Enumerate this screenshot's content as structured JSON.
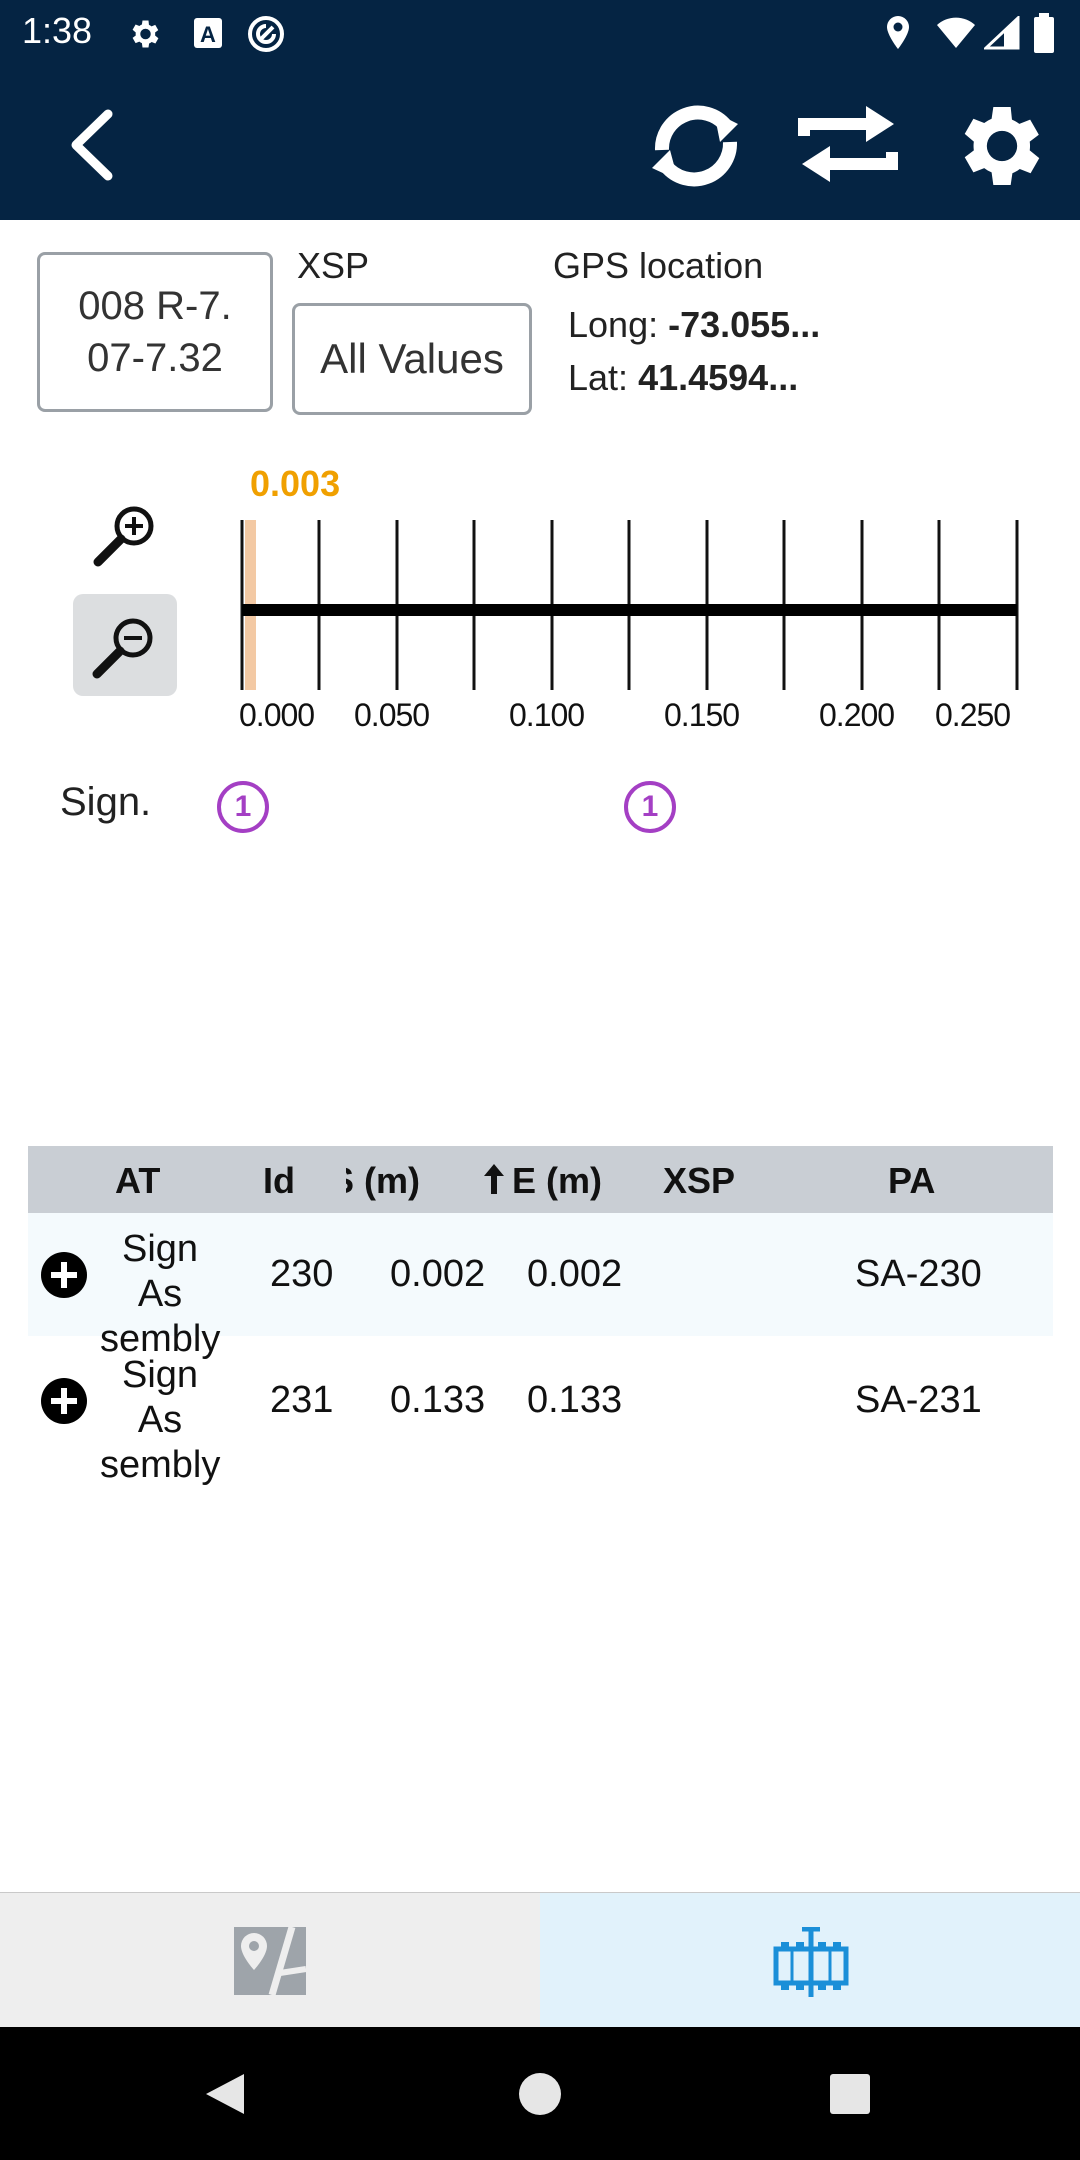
{
  "status_bar": {
    "time": "1:38",
    "left_icons": [
      "gear-icon",
      "font-a-icon",
      "at-sign-icon"
    ],
    "right_icons": [
      "location-pin-icon",
      "wifi-icon",
      "signal-icon",
      "battery-icon"
    ]
  },
  "app_bar": {
    "icons": [
      "back-arrow-icon",
      "sync-icon",
      "swap-direction-icon",
      "settings-icon"
    ],
    "background": "#052443"
  },
  "road": {
    "value": "008  R-7.\n07-7.32"
  },
  "xsp": {
    "label": "XSP",
    "value": "All Values"
  },
  "gps": {
    "title": "GPS location",
    "long_label": "Long: ",
    "long_value": "-73.055...",
    "lat_label": "Lat: ",
    "lat_value": "41.4594..."
  },
  "timeline": {
    "cursor_value": "0.003",
    "tick_labels": [
      "0.000",
      "0.050",
      "0.100",
      "0.150",
      "0.200",
      "0.250"
    ],
    "cursor_color": "#f0a000"
  },
  "sign_track": {
    "label": "Sign.",
    "markers": [
      "1",
      "1"
    ],
    "marker_color": "#a43fc4"
  },
  "table": {
    "columns": [
      "AT",
      "Id",
      "S (m)",
      "E (m)",
      "XSP",
      "PA"
    ],
    "sort_indicator": "up-arrow-icon",
    "rows": [
      {
        "at": "Sign As\nsembly",
        "id": "230",
        "s": "0.002",
        "e": "0.002",
        "xsp": "",
        "pa": "SA-230"
      },
      {
        "at": "Sign As\nsembly",
        "id": "231",
        "s": "0.133",
        "e": "0.133",
        "xsp": "",
        "pa": "SA-231"
      }
    ]
  },
  "bottom_nav": {
    "items": [
      "map-icon",
      "timeline-icon"
    ],
    "active": "timeline-icon",
    "active_color": "#1a8fd8"
  }
}
